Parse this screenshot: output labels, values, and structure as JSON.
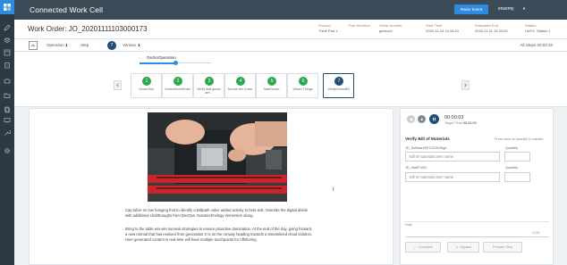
{
  "app": {
    "title": "Connected Work Cell"
  },
  "topbar": {
    "raise_label": "Raise Event",
    "user": "ensemy",
    "caret": "▼"
  },
  "header": {
    "work_order": "Work Order: JO_20201111103000173",
    "meta": [
      {
        "label": "Product",
        "value": "Think Pad 1..."
      },
      {
        "label": "Part Revision",
        "value": ""
      },
      {
        "label": "Serial Number",
        "value": "geckoo1"
      },
      {
        "label": "Start Time",
        "value": "2020-11-24 14:15:43"
      },
      {
        "label": "Estimated End",
        "value": "2020-11-11 12:33:00"
      },
      {
        "label": "Station",
        "value": "LWC1: Station 1"
      }
    ]
  },
  "opbar": {
    "operation_label": "Operation",
    "operation_value": "1",
    "step_label": "Step",
    "step_value": "7",
    "version_label": "Version",
    "version_value": "1",
    "all_steps": "All Steps 00:02:33"
  },
  "stepper": {
    "operation_name": "GeckoOperation",
    "progress_fraction": 0.5,
    "steps": [
      {
        "num": "1",
        "label": "GeckoTool"
      },
      {
        "num": "2",
        "label": "GeckoNeverEnding"
      },
      {
        "num": "3",
        "label": "Verify that gecko are..."
      },
      {
        "num": "4",
        "label": "Secure the Cover"
      },
      {
        "num": "5",
        "label": "SafeGecko"
      },
      {
        "num": "6",
        "label": "Wheel Things"
      },
      {
        "num": "7",
        "label": "VerifyGeckoBill"
      }
    ],
    "active_index": 6
  },
  "instructions": {
    "paragraph_1": "Cap tulize on low hanging fruit to identify a ballpark value added activity to beta test. Override the digital divide with additional clickthroughs from DevOps. Nanotechnology immersion along.",
    "paragraph_2": "Bring to the table win-win survival strategies to ensure proactive domination. At the end of the day, going forward, a new normal that has evolved from generation X is on the runway heading towards a streamlined cloud solution. User generated content in real-time will have multiple touchpoints for offshoring."
  },
  "timer_panel": {
    "elapsed": "00:00:03",
    "target_label": "Target Time",
    "target_value": "00:02:00"
  },
  "bom": {
    "title": "Verify Bill of Materials",
    "hint": "Press enter on quantity to validate",
    "rows": [
      {
        "part_label": "JD_SoftwareFECOUIDSign",
        "qty_label": "Quantity",
        "placeholder": "Bill of materials item name"
      },
      {
        "part_label": "JD_HaltF1002",
        "qty_label": "Quantity",
        "placeholder": "Bill of materials item name"
      }
    ]
  },
  "notes": {
    "label": "Note",
    "count": "0/255"
  },
  "actions": {
    "complete": "Complete",
    "bypass": "Bypass",
    "prepare": "Prepare Step"
  },
  "colors": {
    "primary": "#2f8be0",
    "dark_blue": "#1f4e79",
    "success": "#2ea84e",
    "sidebar": "#2b3a45",
    "topbar": "#3b4b57"
  }
}
